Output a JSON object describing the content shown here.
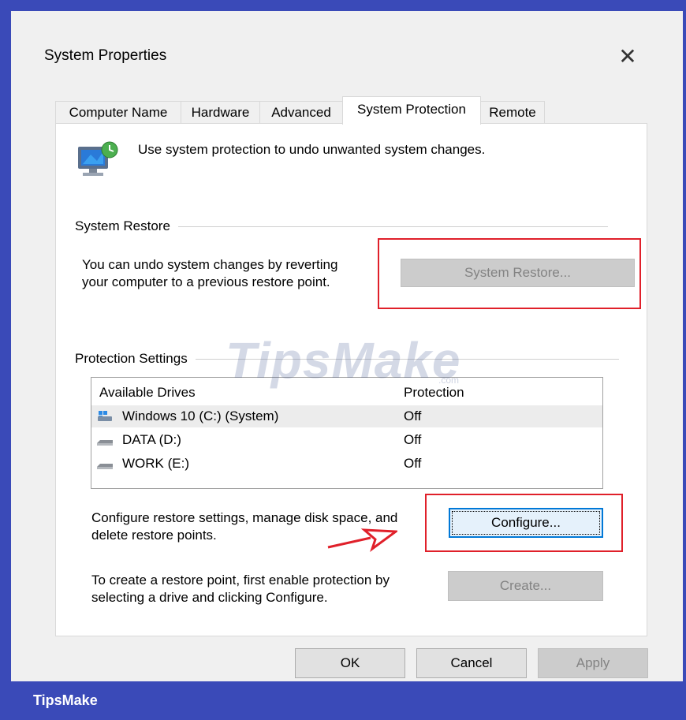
{
  "dialog": {
    "title": "System Properties",
    "close_icon": "close-icon"
  },
  "tabs": [
    {
      "label": "Computer Name"
    },
    {
      "label": "Hardware"
    },
    {
      "label": "Advanced"
    },
    {
      "label": "System Protection",
      "active": true
    },
    {
      "label": "Remote"
    }
  ],
  "intro": {
    "icon": "system-protection-monitor-icon",
    "text": "Use system protection to undo unwanted system changes."
  },
  "system_restore": {
    "group_label": "System Restore",
    "description_line1": "You can undo system changes by reverting",
    "description_line2": "your computer to a previous restore point.",
    "button_label": "System Restore...",
    "button_state": "disabled"
  },
  "protection_settings": {
    "group_label": "Protection Settings",
    "columns": [
      "Available Drives",
      "Protection"
    ],
    "drives": [
      {
        "name": "Windows 10 (C:) (System)",
        "protection": "Off",
        "icon": "windows-drive-icon",
        "selected": true
      },
      {
        "name": "DATA (D:)",
        "protection": "Off",
        "icon": "hard-drive-icon"
      },
      {
        "name": "WORK (E:)",
        "protection": "Off",
        "icon": "hard-drive-icon"
      }
    ],
    "configure_text_line1": "Configure restore settings, manage disk space, and",
    "configure_text_line2": "delete restore points.",
    "configure_button": "Configure...",
    "create_text_line1": "To create a restore point, first enable protection by",
    "create_text_line2": "selecting a drive and clicking Configure.",
    "create_button": "Create..."
  },
  "footer": {
    "ok": "OK",
    "cancel": "Cancel",
    "apply": "Apply"
  },
  "watermark": {
    "text": "TipsMake",
    "suffix": ".com"
  },
  "brand_bar": {
    "text": "TipsMake"
  },
  "colors": {
    "frame": "#3a4ab8",
    "highlight": "#e0202a",
    "focus": "#0078d7"
  }
}
